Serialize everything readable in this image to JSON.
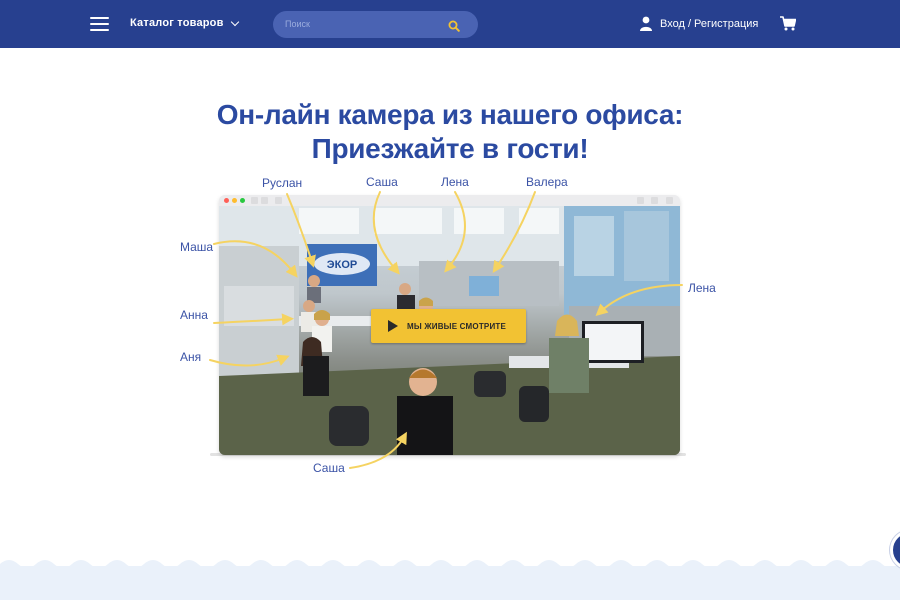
{
  "header": {
    "catalog_label": "Каталог товаров",
    "search_placeholder": "Поиск",
    "login_label": "Вход / Регистрация"
  },
  "main": {
    "title_line1": "Он-лайн камера из нашего офиса:",
    "title_line2": "Приезжайте в гости!",
    "names": {
      "ruslan": "Руслан",
      "sasha_top": "Саша",
      "lena_top": "Лена",
      "valera": "Валера",
      "masha": "Маша",
      "lena_right": "Лена",
      "anna": "Анна",
      "anya": "Аня",
      "sasha_bottom": "Саша"
    },
    "camera": {
      "logo_text": "ЭКОР",
      "play_label": "МЫ ЖИВЫЕ СМОТРИТЕ"
    }
  },
  "colors": {
    "header_bg": "#27408f",
    "title": "#2b4aa1",
    "accent_yellow": "#f2c233",
    "arrow_yellow": "#f5d361"
  },
  "icons": [
    "menu-icon",
    "chevron-down-icon",
    "search-icon",
    "user-icon",
    "cart-icon",
    "play-icon"
  ]
}
